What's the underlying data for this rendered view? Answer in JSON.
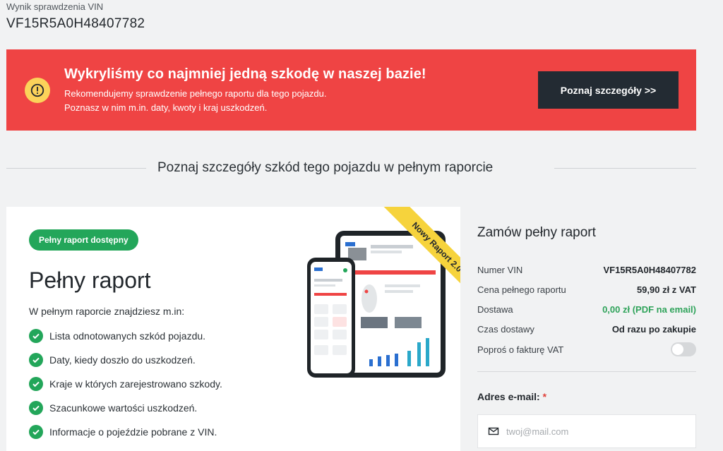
{
  "vin_header": {
    "label": "Wynik sprawdzenia VIN",
    "value": "VF15R5A0H48407782"
  },
  "alert": {
    "title": "Wykryliśmy co najmniej jedną szkodę w naszej bazie!",
    "line1": "Rekomendujemy sprawdzenie pełnego raportu dla tego pojazdu.",
    "line2": "Poznasz w nim m.in. daty, kwoty i kraj uszkodzeń.",
    "button": "Poznaj szczegóły >>",
    "color": "#ef4444",
    "icon": "warning-icon"
  },
  "section_title": "Poznaj szczegóły szkód tego pojazdu w pełnym raporcie",
  "report": {
    "badge": "Pełny raport dostępny",
    "title": "Pełny raport",
    "intro": "W pełnym raporcie znajdziesz m.in:",
    "ribbon": "Nowy Raport 2.0",
    "features": [
      "Lista odnotowanych szkód pojazdu.",
      "Daty, kiedy doszło do uszkodzeń.",
      "Kraje w których zarejestrowano szkody.",
      "Szacunkowe wartości uszkodzeń.",
      "Informacje o pojeździe pobrane z VIN."
    ]
  },
  "order": {
    "title": "Zamów pełny raport",
    "rows": [
      {
        "key": "Numer VIN",
        "value": "VF15R5A0H48407782"
      },
      {
        "key": "Cena pełnego raportu",
        "value": "59,90 zł z VAT"
      },
      {
        "key": "Dostawa",
        "value": "0,00 zł (PDF na email)"
      },
      {
        "key": "Czas dostawy",
        "value": "Od razu po zakupie"
      }
    ],
    "invoice_label": "Poproś o fakturę VAT",
    "invoice_enabled": false,
    "email_label": "Adres e-mail:",
    "email_required_mark": "*",
    "email_placeholder": "twoj@mail.com",
    "email_value": ""
  }
}
